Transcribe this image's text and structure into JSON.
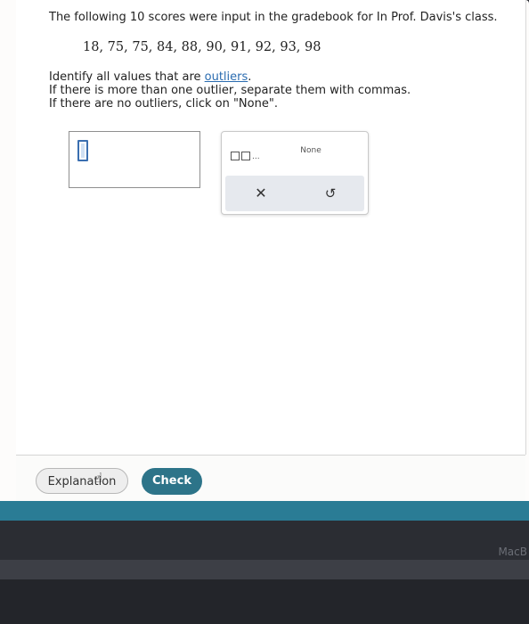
{
  "question": {
    "intro": "The following 10 scores were input in the gradebook for In Prof. Davis's class.",
    "scores": "18, 75, 75, 84, 88, 90, 91, 92, 93, 98",
    "instruction_prefix": "Identify all values that are ",
    "outliers_link": "outliers",
    "instruction_suffix": ".",
    "instruction_2": "If there is more than one outlier, separate them with commas.",
    "instruction_3": "If there are no outliers, click on \"None\"."
  },
  "keypad": {
    "list_dots": "...",
    "none_label": "None",
    "clear_symbol": "✕",
    "undo_symbol": "↺"
  },
  "footer": {
    "explanation_label": "Explanation",
    "check_label": "Check"
  },
  "device": {
    "label": "MacB"
  },
  "colors": {
    "check_button": "#2d7489",
    "link": "#2b6cb0",
    "teal_strip": "#2a7c95"
  }
}
